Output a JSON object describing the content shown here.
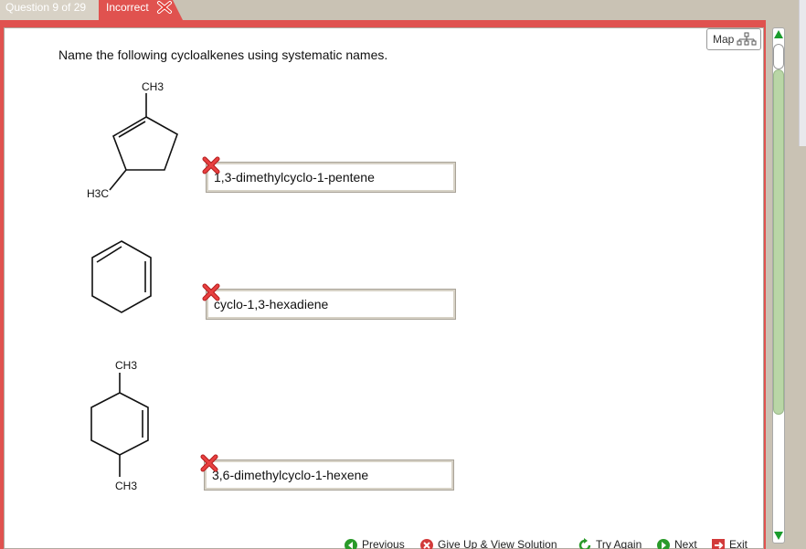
{
  "tabs": {
    "question": "Question 9 of 29",
    "status": "Incorrect"
  },
  "map": {
    "label": "Map"
  },
  "prompt": "Name the following cycloalkenes using systematic names.",
  "molecules": [
    {
      "labels": [
        "CH3",
        "H3C"
      ]
    },
    {
      "labels": []
    },
    {
      "labels": [
        "CH3",
        "CH3"
      ]
    }
  ],
  "answers": [
    {
      "value": "1,3-dimethylcyclo-1-pentene",
      "status": "incorrect"
    },
    {
      "value": "cyclo-1,3-hexadiene",
      "status": "incorrect"
    },
    {
      "value": "3,6-dimethylcyclo-1-hexene",
      "status": "incorrect"
    }
  ],
  "footer": {
    "previous": "Previous",
    "give_up": "Give Up & View Solution",
    "try_again": "Try Again",
    "next": "Next",
    "exit": "Exit"
  },
  "colors": {
    "accent_red": "#e0524f",
    "frame_tan": "#c9c2b4",
    "scroll_green": "#b9d6a6"
  }
}
